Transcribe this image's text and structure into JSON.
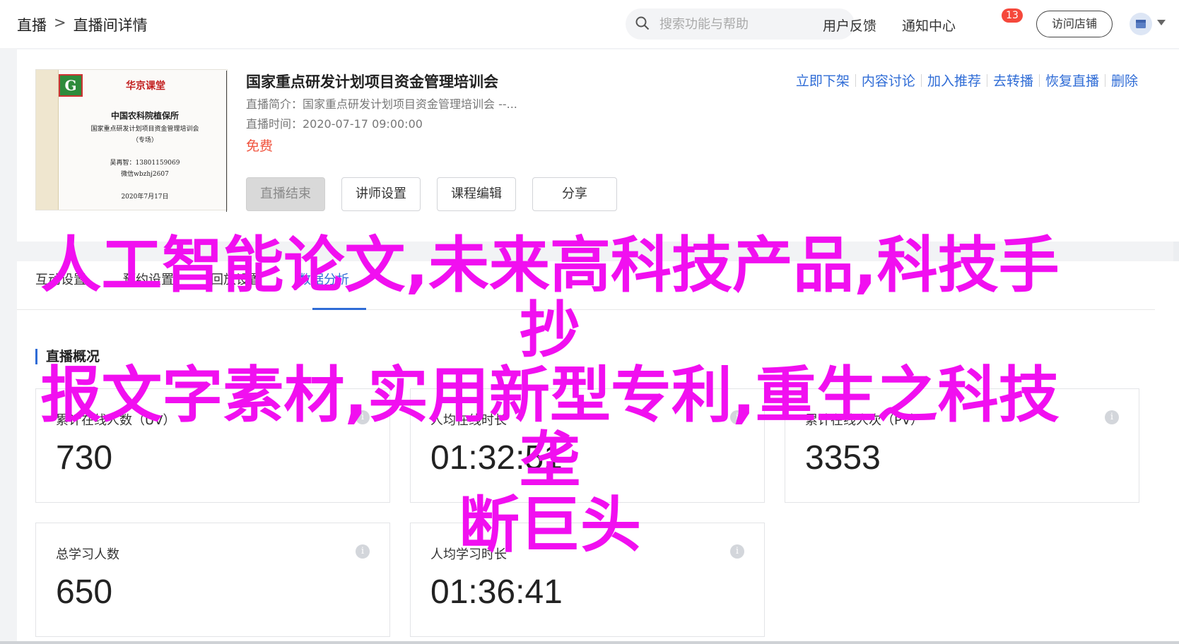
{
  "breadcrumb": {
    "root": "直播",
    "separator": ">",
    "current": "直播间详情"
  },
  "search": {
    "placeholder": "搜索功能与帮助"
  },
  "top_links": {
    "feedback": "用户反馈",
    "notifications": "通知中心",
    "notification_count": "13",
    "visit_store": "访问店铺"
  },
  "poster": {
    "title": "华京课堂",
    "org": "中国农科院植保所",
    "course": "国家重点研发计划项目资金管理培训会",
    "type": "（专场）",
    "contact_line1": "吴再智：13801159069",
    "contact_line2": "微信wbzhj2607",
    "date": "2020年7月17日"
  },
  "live": {
    "title": "国家重点研发计划项目资金管理培训会",
    "intro": "直播简介：国家重点研发计划项目资金管理培训会 --...",
    "time": "直播时间：2020-07-17 09:00:00",
    "price": "免费"
  },
  "actions": [
    "立即下架",
    "内容讨论",
    "加入推荐",
    "去转播",
    "恢复直播",
    "删除"
  ],
  "buttons": {
    "end": "直播结束",
    "teacher": "讲师设置",
    "course_edit": "课程编辑",
    "share": "分享"
  },
  "tabs": [
    "互动设置",
    "预约设置",
    "回放设置",
    "数据分析"
  ],
  "section": {
    "title": "直播概况"
  },
  "stats": [
    {
      "label": "累计在线人数（UV）",
      "value": "730"
    },
    {
      "label": "人均在线时长",
      "value": "01:32:51"
    },
    {
      "label": "累计在线人次（PV）",
      "value": "3353"
    },
    {
      "label": "总学习人数",
      "value": "650"
    },
    {
      "label": "人均学习时长",
      "value": "01:36:41"
    }
  ],
  "overlay": {
    "line1": "人工智能论文,未来高科技产品,科技手抄",
    "line2": "报文字素材,实用新型专利,重生之科技垄",
    "line3": "断巨头"
  },
  "colors": {
    "accent": "#2f6cd6",
    "price": "#f0533e",
    "badge": "#f5483b",
    "overlay": "#f10ff0"
  }
}
